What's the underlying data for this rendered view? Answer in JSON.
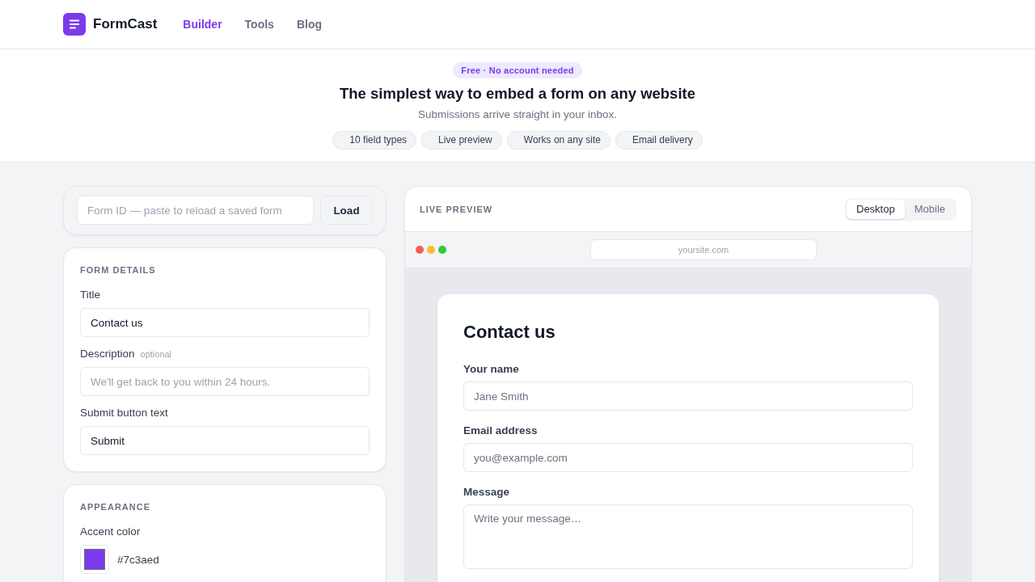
{
  "header": {
    "logo_text": "FormCast",
    "nav": [
      {
        "label": "Builder",
        "selected": true
      },
      {
        "label": "Tools",
        "selected": false
      },
      {
        "label": "Blog",
        "selected": false
      }
    ]
  },
  "hero": {
    "badge": "Free · No account needed",
    "title": "The simplest way to embed a form on any website",
    "subtitle": "Submissions arrive straight in your inbox.",
    "chips": [
      "10 field types",
      "Live preview",
      "Works on any site",
      "Email delivery"
    ]
  },
  "load_form": {
    "placeholder": "Form ID — paste to reload a saved form",
    "button": "Load"
  },
  "form_details": {
    "heading": "FORM DETAILS",
    "fields": [
      {
        "label": "Title",
        "value": "Contact us"
      },
      {
        "label": "Description",
        "hint": "optional",
        "placeholder": "We'll get back to you within 24 hours."
      },
      {
        "label": "Submit button text",
        "value": "Submit"
      }
    ]
  },
  "appearance": {
    "heading": "APPEARANCE",
    "accent": {
      "label": "Accent color",
      "value": "#7c3aed",
      "color": "#7c3aed"
    }
  },
  "preview": {
    "heading": "LIVE PREVIEW",
    "modes": [
      {
        "label": "Desktop",
        "selected": true
      },
      {
        "label": "Mobile",
        "selected": false
      }
    ],
    "url": "yoursite.com",
    "form": {
      "title": "Contact us",
      "fields": [
        {
          "kind": "input",
          "label": "Your name",
          "placeholder": "Jane Smith"
        },
        {
          "kind": "input",
          "label": "Email address",
          "placeholder": "you@example.com"
        },
        {
          "kind": "textarea",
          "label": "Message",
          "placeholder": "Write your message…"
        }
      ]
    }
  }
}
